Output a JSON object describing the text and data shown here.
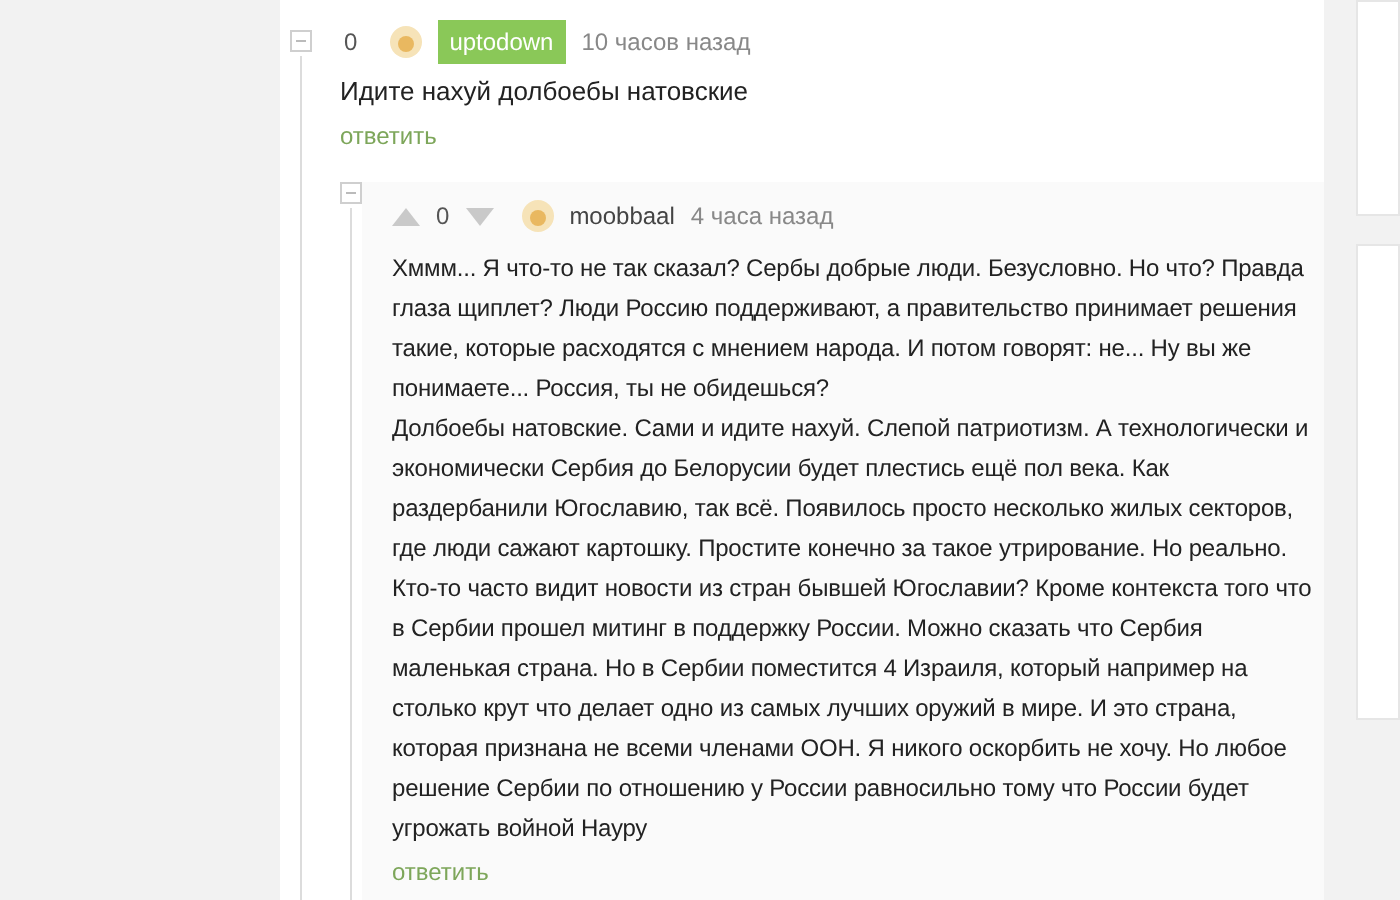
{
  "comments": [
    {
      "score": "0",
      "author": "uptodown",
      "author_badge": true,
      "time": "10 часов назад",
      "voting_arrows": false,
      "text": "Идите нахуй долбоебы натовские",
      "reply": "ответить",
      "children": [
        {
          "score": "0",
          "author": "moobbaal",
          "author_badge": false,
          "time": "4 часа назад",
          "voting_arrows": true,
          "text": "Хммм... Я что-то не так сказал? Сербы добрые люди. Безусловно. Но что? Правда глаза щиплет? Люди Россию поддерживают, а правительство принимает решения такие, которые расходятся с мнением народа. И потом говорят: не... Ну вы же понимаете... Россия, ты не обидешься?\nДолбоебы натовские. Сами и идите нахуй. Слепой патриотизм. А технологически и экономически Сербия до Белорусии будет плестись ещё пол века. Как раздербанили Югославию, так всё. Появилось просто несколько жилых секторов, где люди сажают картошку. Простите конечно за такое утрирование. Но реально. Кто-то часто видит новости из стран бывшей Югославии? Кроме контекста того что в Сербии прошел митинг в поддержку России. Можно сказать что Сербия маленькая страна. Но в Сербии поместится 4 Израиля, который например на столько крут что делает одно из самых лучших оружий в мире. И это страна, которая признана не всеми членами ООН. Я никого оскорбить не хочу. Но любое решение Сербии по отношению у России равносильно тому что России будет угрожать войной Науру",
          "reply": "ответить"
        }
      ]
    }
  ]
}
